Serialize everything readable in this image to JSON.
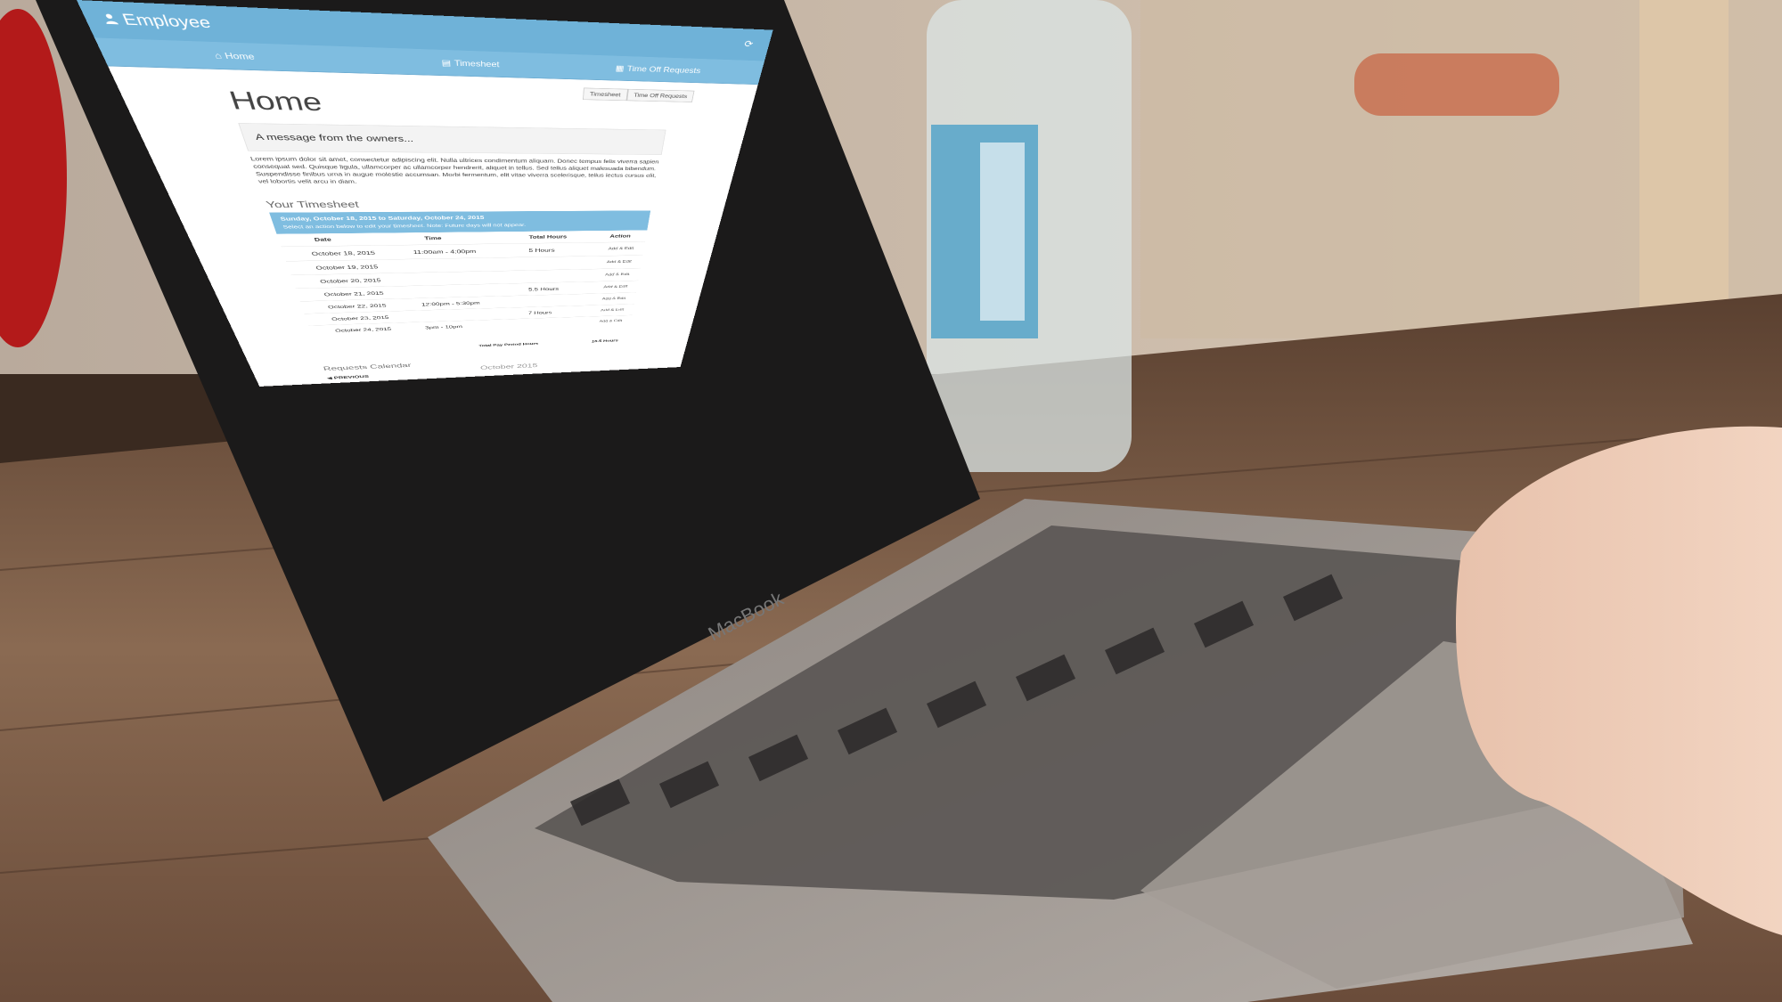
{
  "colors": {
    "accent": "#6fb2d8",
    "accent_light": "#7fbde0",
    "text": "#333333"
  },
  "app": {
    "brand": "Employee",
    "brand_icon": "user-icon",
    "nav_right_icon": "refresh-icon"
  },
  "nav": {
    "home": "Home",
    "timesheet": "Timesheet",
    "time_off": "Time Off Requests"
  },
  "subtabs": [
    "Timesheet",
    "Time Off Requests"
  ],
  "page": {
    "title": "Home",
    "message_title": "A message from the owners...",
    "message_body": "Lorem ipsum dolor sit amet, consectetur adipiscing elit. Nulla ultrices condimentum aliquam. Donec tempus felis viverra sapien consequat sed. Quisque ligula, ullamcorper ac ullamcorper hendrerit, aliquet in tellus. Sed tellus aliquet malesuada bibendum. Suspendisse finibus urna in augue molestie accumsan. Morbi fermentum, elit vitae viverra scelerisque, tellus lectus cursus elit, vel lobortis velit arcu in diam."
  },
  "timesheet": {
    "title": "Your Timesheet",
    "period": "Sunday, October 18, 2015 to Saturday, October 24, 2015",
    "note": "Select an action below to edit your timesheet. Note: Future days will not appear.",
    "headers": {
      "date": "Date",
      "time": "Time",
      "total": "Total Hours",
      "action": "Action"
    },
    "rows": [
      {
        "date": "October 18, 2015",
        "time": "11:00am - 4:00pm",
        "total": "5 Hours",
        "action": "Add & Edit"
      },
      {
        "date": "October 19, 2015",
        "time": "",
        "total": "",
        "action": "Add & Edit"
      },
      {
        "date": "October 20, 2015",
        "time": "",
        "total": "",
        "action": "Add & Edit"
      },
      {
        "date": "October 21, 2015",
        "time": "",
        "total": "5.5 Hours",
        "action": "Add & Edit"
      },
      {
        "date": "October 22, 2015",
        "time": "12:00pm - 5:30pm",
        "total": "",
        "action": "Add & Edit"
      },
      {
        "date": "October 23, 2015",
        "time": "",
        "total": "7 Hours",
        "action": "Add & Edit"
      },
      {
        "date": "October 24, 2015",
        "time": "3pm - 10pm",
        "total": "",
        "action": "Add & Edit"
      }
    ],
    "total_label": "Total Pay Period Hours",
    "total_value": "18.5 Hours"
  },
  "calendar": {
    "title": "Requests Calendar",
    "month": "October 2015",
    "prev": "PREVIOUS"
  },
  "laptop": {
    "label": "MacBook"
  }
}
